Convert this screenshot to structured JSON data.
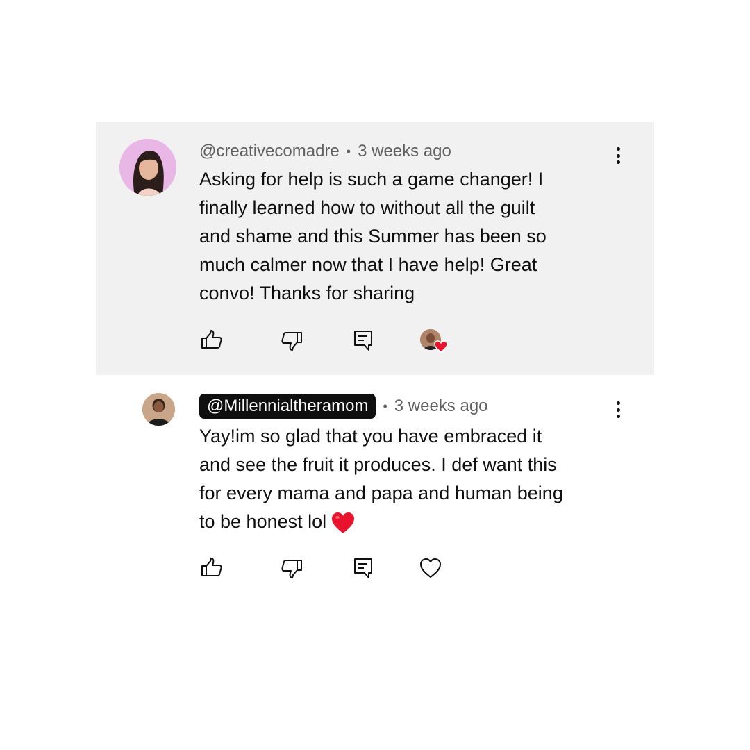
{
  "comments": [
    {
      "handle": "@creativecomadre",
      "separator": "•",
      "time": "3 weeks ago",
      "lines": [
        "Asking for help is such a game changer! I",
        "finally learned how to without all the guilt",
        "and shame and this Summer has been so",
        "much calmer now that I have help! Great",
        "convo! Thanks for sharing"
      ],
      "creator_hearted": true
    },
    {
      "handle": "@Millennialtheramom",
      "separator": "•",
      "time": "3 weeks ago",
      "lines": [
        "Yay!im so glad that you have embraced it",
        "and see the fruit it produces. I def want this",
        "for every mama and papa and human being",
        "to be honest lol"
      ],
      "trailing_emoji": "red-heart-emoji",
      "creator_hearted": false
    }
  ],
  "icons": {
    "like": "thumbs-up-icon",
    "dislike": "thumbs-down-icon",
    "reply": "reply-comment-icon",
    "heart": "heart-outline-icon",
    "more": "more-vertical-icon"
  },
  "colors": {
    "highlight_bg": "#f1f1f1",
    "owner_badge_bg": "#0f0f0f",
    "heart_red": "#e8132c",
    "meta_gray": "#606060"
  }
}
